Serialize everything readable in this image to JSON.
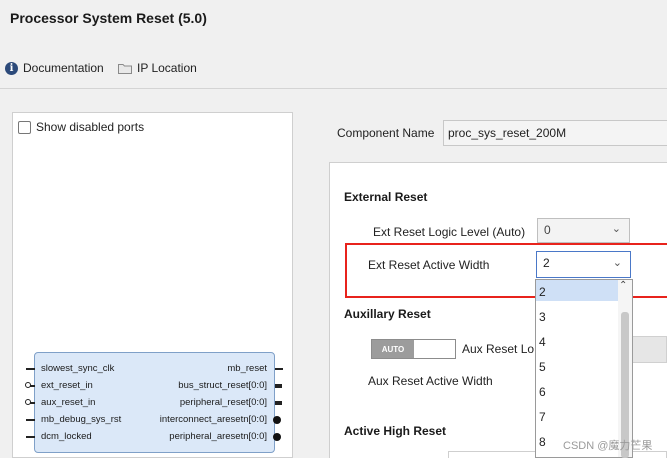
{
  "window": {
    "title": "Processor System Reset (5.0)"
  },
  "toolbar": {
    "documentation": "Documentation",
    "ip_location": "IP Location"
  },
  "symbol": {
    "show_disabled_ports": "Show disabled ports",
    "left_ports": [
      "slowest_sync_clk",
      "ext_reset_in",
      "aux_reset_in",
      "mb_debug_sys_rst",
      "dcm_locked"
    ],
    "right_ports": [
      "mb_reset",
      "bus_struct_reset[0:0]",
      "peripheral_reset[0:0]",
      "interconnect_aresetn[0:0]",
      "peripheral_aresetn[0:0]"
    ]
  },
  "config": {
    "component_name_label": "Component Name",
    "component_name_value": "proc_sys_reset_200M",
    "external_reset": {
      "heading": "External Reset",
      "logic_level_label": "Ext Reset Logic Level (Auto)",
      "logic_level_value": "0",
      "active_width_label": "Ext Reset Active Width",
      "active_width_value": "2"
    },
    "aux_reset": {
      "heading": "Auxillary Reset",
      "toggle_label": "AUTO",
      "logic_level_label": "Aux Reset Lo",
      "active_width_label": "Aux Reset Active Width"
    },
    "active_high_reset": {
      "heading": "Active High Reset"
    }
  },
  "dropdown": {
    "options": [
      "2",
      "3",
      "4",
      "5",
      "6",
      "7",
      "8"
    ],
    "selected": "2"
  },
  "watermark": "CSDN @魔力芒果",
  "colors": {
    "highlight": "#e8231c",
    "selection": "#cfe0f6",
    "block_fill": "#dbe8f8",
    "block_border": "#7fa0c8"
  }
}
